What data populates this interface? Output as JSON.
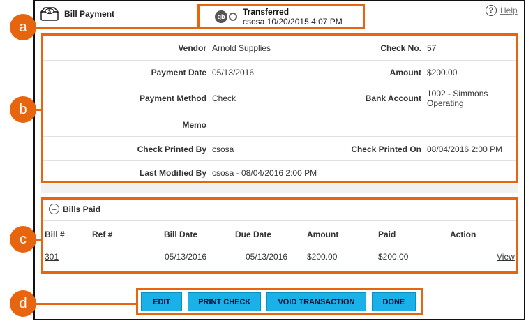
{
  "header": {
    "title": "Bill Payment"
  },
  "status": {
    "title": "Transferred",
    "detail": "csosa 10/20/2015 4:07 PM",
    "qb_label": "qb"
  },
  "help": {
    "label": "Help",
    "icon_glyph": "?"
  },
  "details": {
    "vendor_label": "Vendor",
    "vendor": "Arnold Supplies",
    "check_no_label": "Check No.",
    "check_no": "57",
    "payment_date_label": "Payment Date",
    "payment_date": "05/13/2016",
    "amount_label": "Amount",
    "amount": "$200.00",
    "payment_method_label": "Payment Method",
    "payment_method": "Check",
    "bank_account_label": "Bank Account",
    "bank_account": "1002 - Simmons Operating",
    "memo_label": "Memo",
    "memo": "",
    "printed_by_label": "Check Printed By",
    "printed_by": "csosa",
    "printed_on_label": "Check Printed On",
    "printed_on": "08/04/2016 2:00 PM",
    "modified_by_label": "Last Modified By",
    "modified_by": "csosa - 08/04/2016 2:00 PM"
  },
  "bills": {
    "section_title": "Bills Paid",
    "columns": [
      "Bill #",
      "Ref #",
      "Bill Date",
      "Due Date",
      "Amount",
      "Paid",
      "Action"
    ],
    "rows": [
      {
        "bill_no": "301",
        "ref_no": "",
        "bill_date": "05/13/2016",
        "due_date": "05/13/2016",
        "amount": "$200.00",
        "paid": "$200.00",
        "action": "View"
      }
    ]
  },
  "actions": {
    "edit": "EDIT",
    "print_check": "PRINT CHECK",
    "void": "VOID TRANSACTION",
    "done": "DONE"
  },
  "callouts": {
    "a": "a",
    "b": "b",
    "c": "c",
    "d": "d"
  },
  "colors": {
    "accent": "#e8650f",
    "button": "#1ab0e8"
  },
  "icons": {
    "logo": "check-register-icon",
    "qb": "quickbooks-icon",
    "sync": "sync-icon",
    "help": "help-icon",
    "collapse": "minus-circle-icon"
  }
}
